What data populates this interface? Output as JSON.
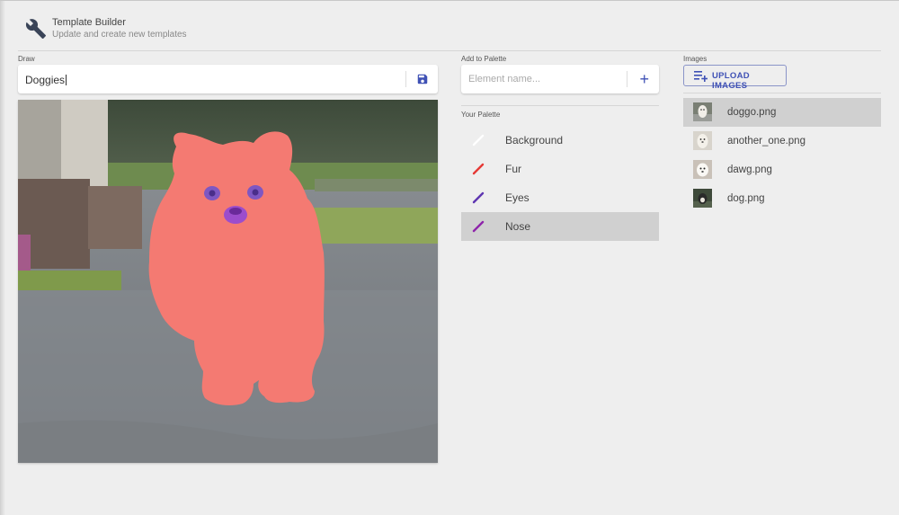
{
  "header": {
    "icon": "wrench-icon",
    "title": "Template Builder",
    "subtitle": "Update and create new templates"
  },
  "draw": {
    "section_label": "Draw",
    "name_value": "Doggies",
    "save_icon": "save-icon"
  },
  "add_palette": {
    "section_label": "Add to Palette",
    "placeholder": "Element name...",
    "add_icon": "plus-icon",
    "add_symbol": "+"
  },
  "palette": {
    "section_label": "Your Palette",
    "items": [
      {
        "label": "Background",
        "color": "#ffffff",
        "icon": "brush-icon",
        "selected": false
      },
      {
        "label": "Fur",
        "color": "#e53935",
        "icon": "brush-icon",
        "selected": false
      },
      {
        "label": "Eyes",
        "color": "#5e35b1",
        "icon": "brush-icon",
        "selected": false
      },
      {
        "label": "Nose",
        "color": "#8e24aa",
        "icon": "brush-icon",
        "selected": true
      }
    ]
  },
  "images": {
    "section_label": "Images",
    "upload_label": "UPLOAD IMAGES",
    "upload_icon": "playlist-add-icon",
    "files": [
      {
        "name": "doggo.png",
        "selected": true
      },
      {
        "name": "another_one.png",
        "selected": false
      },
      {
        "name": "dawg.png",
        "selected": false
      },
      {
        "name": "dog.png",
        "selected": false
      }
    ]
  },
  "colors": {
    "accent": "#3f51b5",
    "fur_overlay": "#f47a72",
    "eyes_overlay": "#7e57c2",
    "nose_overlay": "#9c4dcc",
    "selected_row": "#d0d0d0"
  }
}
